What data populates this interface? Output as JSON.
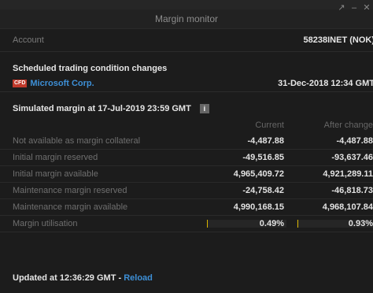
{
  "window": {
    "pin_icon": "pin-icon",
    "minimize_icon": "minimize-icon",
    "close_icon": "close-icon"
  },
  "title": "Margin monitor",
  "account": {
    "label": "Account",
    "value": "58238INET (NOK)"
  },
  "scheduled": {
    "title": "Scheduled trading condition changes",
    "badge": "CFD",
    "instrument": "Microsoft Corp.",
    "date": "31-Dec-2018 12:34 GMT"
  },
  "simulated": {
    "title": "Simulated margin at 17-Jul-2019 23:59 GMT",
    "info_icon": "i"
  },
  "table": {
    "headers": {
      "current": "Current",
      "after": "After change"
    },
    "rows": [
      {
        "label": "Not available as margin collateral",
        "current": "-4,487.88",
        "after": "-4,487.88"
      },
      {
        "label": "Initial margin reserved",
        "current": "-49,516.85",
        "after": "-93,637.46"
      },
      {
        "label": "Initial margin available",
        "current": "4,965,409.72",
        "after": "4,921,289.11"
      },
      {
        "label": "Maintenance margin reserved",
        "current": "-24,758.42",
        "after": "-46,818.73"
      },
      {
        "label": "Maintenance margin available",
        "current": "4,990,168.15",
        "after": "4,968,107.84"
      }
    ],
    "utilisation": {
      "label": "Margin utilisation",
      "current": "0.49%",
      "after": "0.93%",
      "current_fraction": 0.0049,
      "after_fraction": 0.0093,
      "bar_color": "#d8b400"
    }
  },
  "footer": {
    "updated": "Updated at 12:36:29 GMT - ",
    "reload": "Reload"
  },
  "colors": {
    "link": "#3d8fd6",
    "badge": "#c0392b"
  }
}
